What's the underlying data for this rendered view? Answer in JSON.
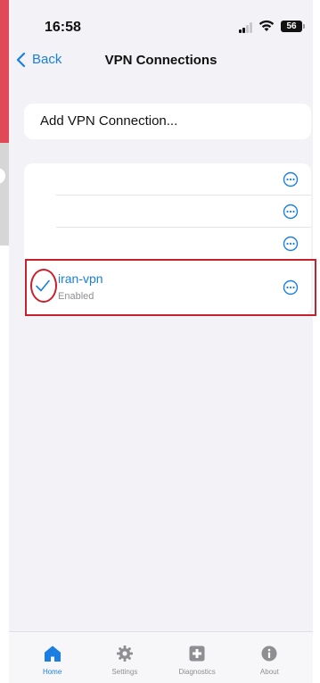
{
  "status_bar": {
    "time": "16:58",
    "battery": "56"
  },
  "nav": {
    "back_label": "Back",
    "title": "VPN Connections"
  },
  "add_connection": {
    "label": "Add VPN Connection..."
  },
  "vpn_list": {
    "selected": {
      "name": "iran-vpn",
      "status": "Enabled"
    }
  },
  "tabs": [
    {
      "label": "Home",
      "icon": "home-icon",
      "active": true
    },
    {
      "label": "Settings",
      "icon": "gear-icon",
      "active": false
    },
    {
      "label": "Diagnostics",
      "icon": "diagnostics-icon",
      "active": false
    },
    {
      "label": "About",
      "icon": "info-icon",
      "active": false
    }
  ],
  "colors": {
    "accent": "#1a7fe0",
    "annotation": "#c8202f",
    "background": "#f2f2f7"
  }
}
